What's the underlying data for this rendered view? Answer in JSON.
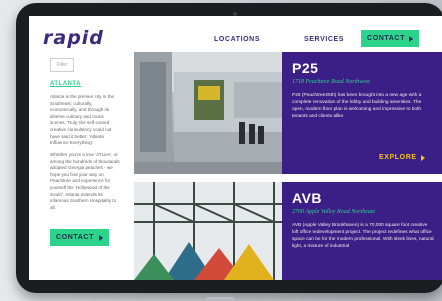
{
  "brand": "rapid",
  "nav": {
    "locations": "LOCATIONS",
    "services": "SERVICES",
    "contact": "CONTACT"
  },
  "sidebar": {
    "filter_placeholder": "Filter",
    "city": "ATLANTA",
    "para1": "Atlanta is the premier city in the Southeast; culturally, economically, and through its diverse culinary and music scenes. Truly, the self-coined creative consultancy could not have said it better: 'Atlanta Influence Everything'.",
    "para2": "Whether you're a true 'ATLien', or among the hundreds of thousands adopted Georgia peaches - we hope you find your way on Peachtree and experience for yourself the 'Hollywood of the South'. Atlanta extends its infamous Southern Hospitality to all.",
    "contact": "CONTACT"
  },
  "listings": [
    {
      "name": "P25",
      "address": "1718 Peachtree Road Northwest",
      "description": "P25 (Peachtree25th) has been brought into a new age with a complete renovation of the lobby and building amenities. The open, modern floor plan is welcoming and impressive to both tenants and clients alike.",
      "cta": "EXPLORE"
    },
    {
      "name": "AVB",
      "address": "2700 Apple Valley Road Northeast",
      "description": "AVB (Apple Valley Brookhaven) is a 70,000 square foot creative loft office redevelopment project. The project redefines what office space can be for the modern professional. With sleek lines, natural light, a mixture of industrial"
    }
  ],
  "colors": {
    "accent_green": "#2bd48a",
    "purple": "#3b1f86",
    "yellow": "#f3c21b",
    "brand": "#3a2c7a"
  }
}
